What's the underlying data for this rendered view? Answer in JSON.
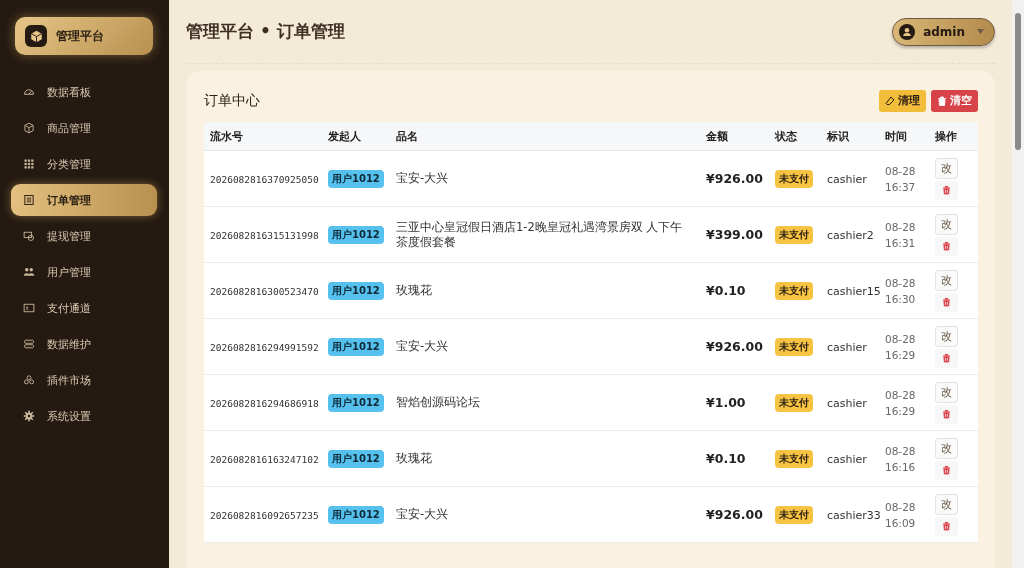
{
  "sidebar": {
    "brand": "管理平台",
    "items": [
      {
        "label": "数据看板",
        "selected": false
      },
      {
        "label": "商品管理",
        "selected": false
      },
      {
        "label": "分类管理",
        "selected": false
      },
      {
        "label": "订单管理",
        "selected": true
      },
      {
        "label": "提现管理",
        "selected": false
      },
      {
        "label": "用户管理",
        "selected": false
      },
      {
        "label": "支付通道",
        "selected": false
      },
      {
        "label": "数据维护",
        "selected": false
      },
      {
        "label": "插件市场",
        "selected": false
      },
      {
        "label": "系统设置",
        "selected": false
      }
    ]
  },
  "header": {
    "title": "管理平台 • 订单管理",
    "user": "admin"
  },
  "card": {
    "title": "订单中心",
    "buttons": [
      {
        "label": "清理",
        "kind": "clean"
      },
      {
        "label": "清空",
        "kind": "clear"
      }
    ]
  },
  "table": {
    "columns": [
      "流水号",
      "发起人",
      "品名",
      "金额",
      "状态",
      "标识",
      "时间",
      "操作"
    ],
    "rows": [
      {
        "serial": "2026082816370925050",
        "user": "用户1012",
        "name": "宝安-大兴",
        "amount": "¥926.00",
        "status": "未支付",
        "tag": "cashier",
        "date": "08-28",
        "time": "16:37",
        "edit": "改"
      },
      {
        "serial": "2026082816315131998",
        "user": "用户1012",
        "name": "三亚中心皇冠假日酒店1-2晚皇冠礼遇湾景房双 人下午茶度假套餐",
        "amount": "¥399.00",
        "status": "未支付",
        "tag": "cashier2",
        "date": "08-28",
        "time": "16:31",
        "edit": "改"
      },
      {
        "serial": "2026082816300523470",
        "user": "用户1012",
        "name": "玫瑰花",
        "amount": "¥0.10",
        "status": "未支付",
        "tag": "cashier15",
        "date": "08-28",
        "time": "16:30",
        "edit": "改"
      },
      {
        "serial": "2026082816294991592",
        "user": "用户1012",
        "name": "宝安-大兴",
        "amount": "¥926.00",
        "status": "未支付",
        "tag": "cashier",
        "date": "08-28",
        "time": "16:29",
        "edit": "改"
      },
      {
        "serial": "2026082816294686918",
        "user": "用户1012",
        "name": "智焰创源码论坛",
        "amount": "¥1.00",
        "status": "未支付",
        "tag": "cashier",
        "date": "08-28",
        "time": "16:29",
        "edit": "改"
      },
      {
        "serial": "2026082816163247102",
        "user": "用户1012",
        "name": "玫瑰花",
        "amount": "¥0.10",
        "status": "未支付",
        "tag": "cashier",
        "date": "08-28",
        "time": "16:16",
        "edit": "改"
      },
      {
        "serial": "2026082816092657235",
        "user": "用户1012",
        "name": "宝安-大兴",
        "amount": "¥926.00",
        "status": "未支付",
        "tag": "cashier33",
        "date": "08-28",
        "time": "16:09",
        "edit": "改"
      }
    ]
  }
}
